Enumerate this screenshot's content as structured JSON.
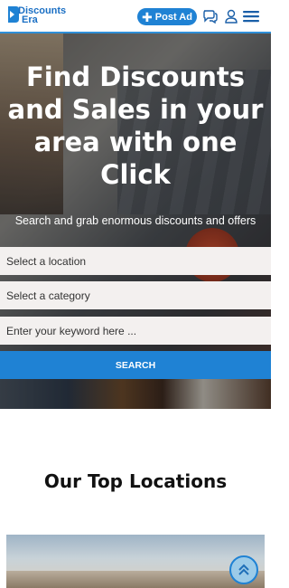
{
  "header": {
    "logo": {
      "line1": "Discounts",
      "line2": "Era"
    },
    "post_ad_label": "Post Ad",
    "icons": [
      "chat-icon",
      "user-icon",
      "menu-icon"
    ]
  },
  "hero": {
    "title": "Find Discounts and Sales in your area with one Click",
    "subtitle": "Search and grab enormous discounts and offers"
  },
  "search_form": {
    "location_select": "Select a location",
    "category_select": "Select a category",
    "keyword_placeholder": "Enter your keyword here ...",
    "search_label": "SEARCH"
  },
  "sections": {
    "top_locations_title": "Our Top Locations"
  },
  "colors": {
    "accent": "#1f82d4",
    "field_bg": "#f3f0ef"
  }
}
